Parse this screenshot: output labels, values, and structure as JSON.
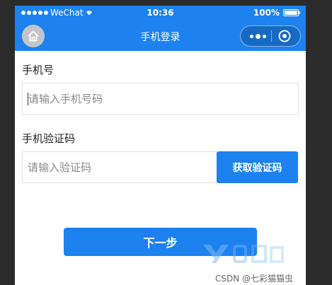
{
  "status_bar": {
    "carrier": "WeChat",
    "time": "10:36",
    "battery": "100%",
    "battery_level": 1.0
  },
  "nav_bar": {
    "title": "手机登录",
    "home_icon": "home-icon",
    "menu_icon": "more-dots-icon",
    "close_icon": "capsule-close-icon"
  },
  "form": {
    "phone_label": "手机号",
    "phone_placeholder": "请输入手机号码",
    "code_label": "手机验证码",
    "code_placeholder": "请输入验证码",
    "get_code_button": "获取验证码",
    "next_button": "下一步"
  },
  "watermark": {
    "text": "CSDN @七彩猫猫虫"
  },
  "colors": {
    "accent": "#1d82f0",
    "background": "#2b2b2b",
    "input_border": "#e0e0e0"
  }
}
